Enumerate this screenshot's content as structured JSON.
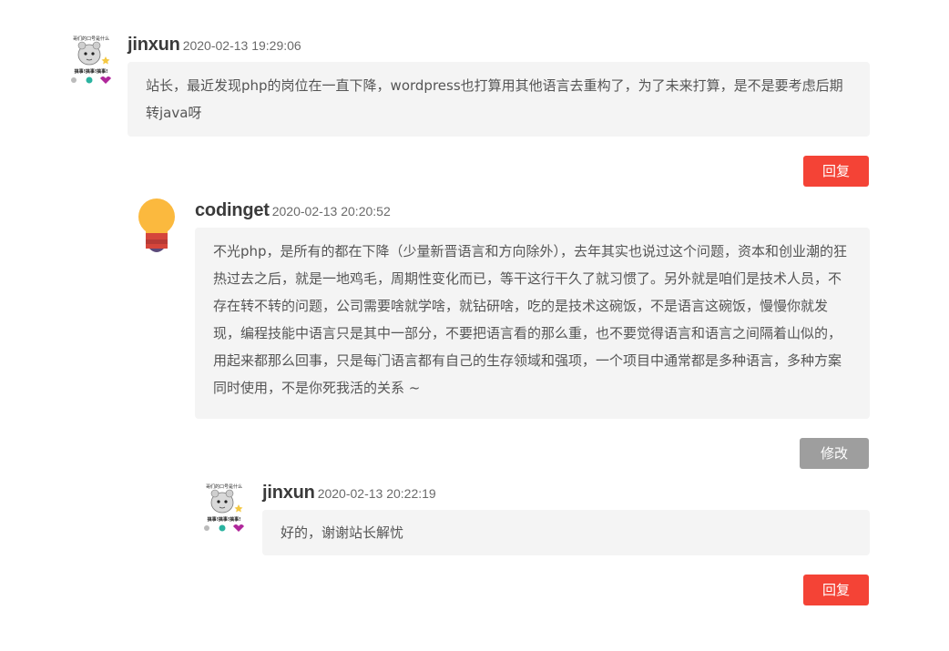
{
  "comments": [
    {
      "author": "jinxun",
      "time": "2020-02-13 19:29:06",
      "avatar_text": [
        "哥们的口号是什么",
        "搞事!搞事!搞事!"
      ],
      "body": "站长，最近发现php的岗位在一直下降，wordpress也打算用其他语言去重构了，为了未来打算，是不是要考虑后期转java呀",
      "action": "回复"
    },
    {
      "author": "codinget",
      "time": "2020-02-13 20:20:52",
      "avatar_icon": "lightbulb-icon",
      "body": "不光php，是所有的都在下降（少量新晋语言和方向除外），去年其实也说过这个问题，资本和创业潮的狂热过去之后，就是一地鸡毛，周期性变化而已，等干这行干久了就习惯了。另外就是咱们是技术人员，不存在转不转的问题，公司需要啥就学啥，就钻研啥，吃的是技术这碗饭，不是语言这碗饭，慢慢你就发现，编程技能中语言只是其中一部分，不要把语言看的那么重，也不要觉得语言和语言之间隔着山似的，用起来都那么回事，只是每门语言都有自己的生存领域和强项，一个项目中通常都是多种语言，多种方案同时使用，不是你死我活的关系 ~",
      "action": "修改"
    },
    {
      "author": "jinxun",
      "time": "2020-02-13 20:22:19",
      "avatar_text": [
        "哥们的口号是什么",
        "搞事!搞事!搞事!"
      ],
      "body": "好的，谢谢站长解忧",
      "action": "回复"
    }
  ],
  "colors": {
    "reply_button": "#f44336",
    "edit_button": "#9e9e9e",
    "bubble": "#f4f4f4"
  }
}
